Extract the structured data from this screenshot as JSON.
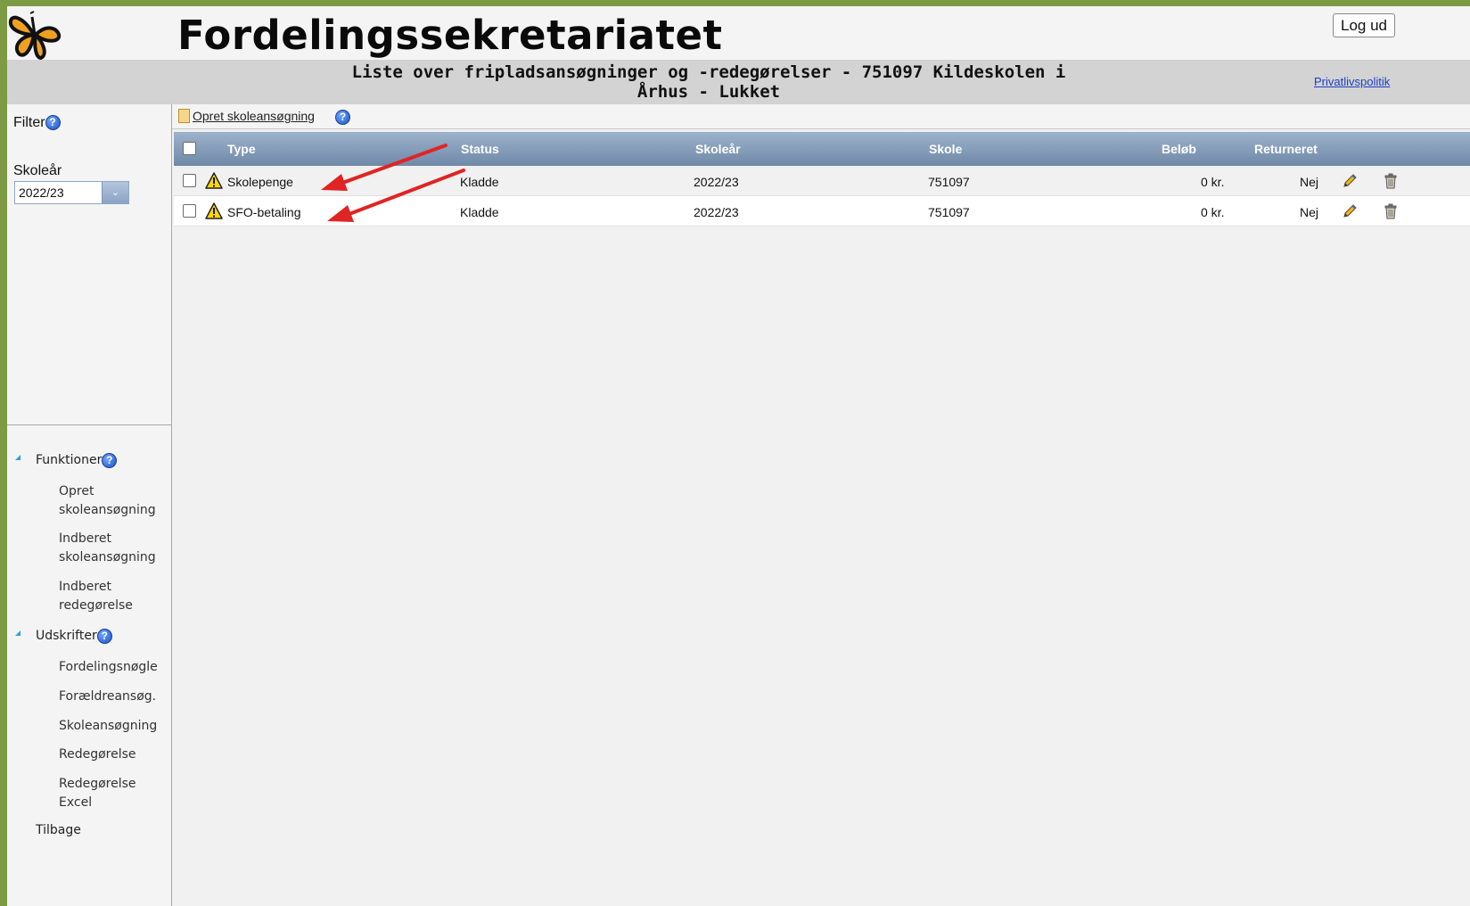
{
  "header": {
    "app_title": "Fordelingssekretariatet",
    "logout_label": "Log ud"
  },
  "subheader": {
    "heading_line1": "Liste over fripladsansøgninger og -redegørelser - 751097 Kildeskolen i",
    "heading_line2": "Århus - Lukket",
    "privacy_link": "Privatlivspolitik"
  },
  "sidebar": {
    "filter_label": "Filter",
    "year_label": "Skoleår",
    "year_value": "2022/23",
    "groups": [
      {
        "label": "Funktioner",
        "items": [
          {
            "line1": "Opret",
            "line2": "skoleansøgning"
          },
          {
            "line1": "Indberet",
            "line2": "skoleansøgning"
          },
          {
            "line1": "Indberet",
            "line2": "redegørelse"
          }
        ]
      },
      {
        "label": "Udskrifter",
        "items": [
          {
            "line1": "Fordelingsnøgle"
          },
          {
            "line1": "Forældreansøg."
          },
          {
            "line1": "Skoleansøgning"
          },
          {
            "line1": "Redegørelse"
          },
          {
            "line1": "Redegørelse",
            "line2": "Excel"
          }
        ]
      }
    ],
    "back_label": "Tilbage"
  },
  "toolbar": {
    "create_label": "Opret skoleansøgning"
  },
  "table": {
    "columns": [
      "Type",
      "Status",
      "Skoleår",
      "Skole",
      "Beløb",
      "Returneret"
    ],
    "rows": [
      {
        "type": "Skolepenge",
        "status": "Kladde",
        "year": "2022/23",
        "school": "751097",
        "amount": "0 kr.",
        "returned": "Nej"
      },
      {
        "type": "SFO-betaling",
        "status": "Kladde",
        "year": "2022/23",
        "school": "751097",
        "amount": "0 kr.",
        "returned": "Nej"
      }
    ]
  },
  "colors": {
    "outer_border": "#7d9a45",
    "header_grad_top": "#9db2cc",
    "header_grad_bottom": "#6f89a8",
    "annotation_arrow": "#e02424",
    "link": "#1a3fc8"
  },
  "icons": [
    "butterfly-logo",
    "help-icon",
    "document-icon",
    "warning-icon",
    "pencil-icon",
    "trash-icon",
    "chevron-down-icon",
    "triangle-expand-icon"
  ]
}
